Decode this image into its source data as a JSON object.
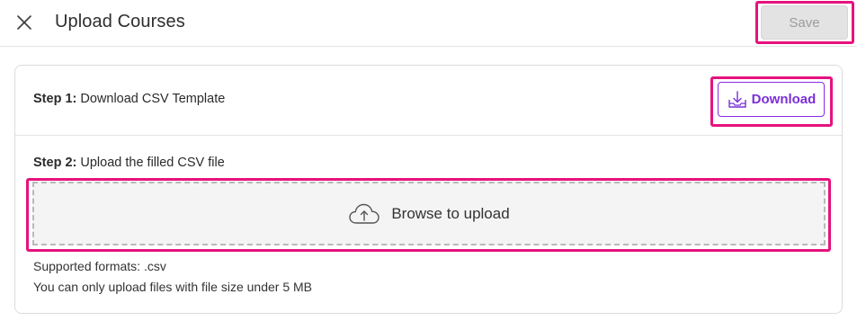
{
  "header": {
    "title": "Upload Courses",
    "close_icon": "close-icon",
    "save_label": "Save"
  },
  "step1": {
    "prefix": "Step 1:",
    "text": " Download CSV Template",
    "download_label": "Download",
    "download_icon": "download-icon"
  },
  "step2": {
    "prefix": "Step 2:",
    "text": " Upload the filled CSV file",
    "upload_label": "Browse to upload",
    "upload_icon": "cloud-upload-icon"
  },
  "hints": {
    "formats": "Supported formats: .csv",
    "size": "You can only upload files with file size under 5 MB"
  },
  "colors": {
    "accent": "#7b2fd6",
    "highlight": "#e6127e",
    "disabled_bg": "#e3e3e3"
  }
}
